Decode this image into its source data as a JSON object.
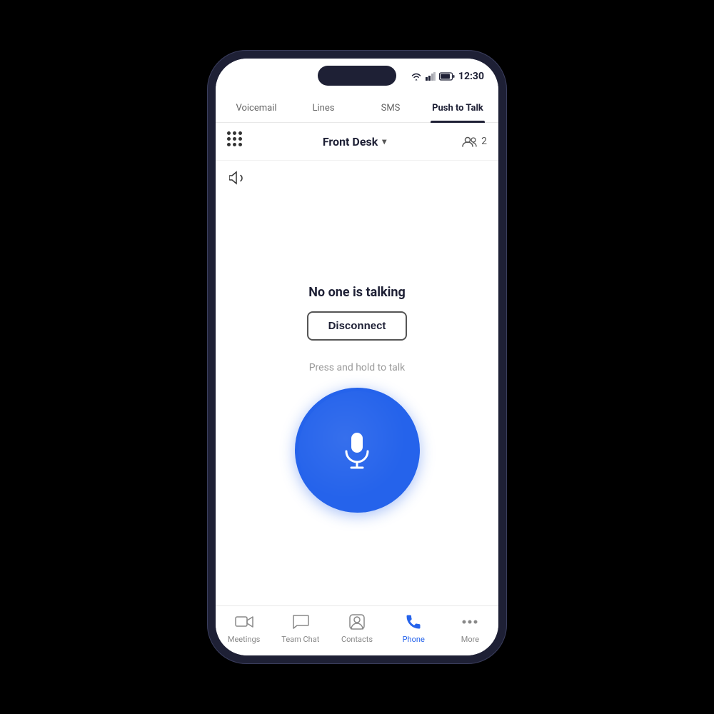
{
  "statusBar": {
    "time": "12:30"
  },
  "topTabs": {
    "tabs": [
      {
        "id": "voicemail",
        "label": "Voicemail",
        "active": false
      },
      {
        "id": "lines",
        "label": "Lines",
        "active": false
      },
      {
        "id": "sms",
        "label": "SMS",
        "active": false
      },
      {
        "id": "push-to-talk",
        "label": "Push to Talk",
        "active": true
      }
    ]
  },
  "channelHeader": {
    "channelName": "Front Desk",
    "membersCount": "2"
  },
  "mainContent": {
    "statusText": "No one is talking",
    "disconnectLabel": "Disconnect",
    "pressHoldText": "Press and hold to talk"
  },
  "bottomNav": {
    "items": [
      {
        "id": "meetings",
        "label": "Meetings",
        "active": false
      },
      {
        "id": "team-chat",
        "label": "Team Chat",
        "active": false
      },
      {
        "id": "contacts",
        "label": "Contacts",
        "active": false
      },
      {
        "id": "phone",
        "label": "Phone",
        "active": true
      },
      {
        "id": "more",
        "label": "More",
        "active": false
      }
    ]
  }
}
